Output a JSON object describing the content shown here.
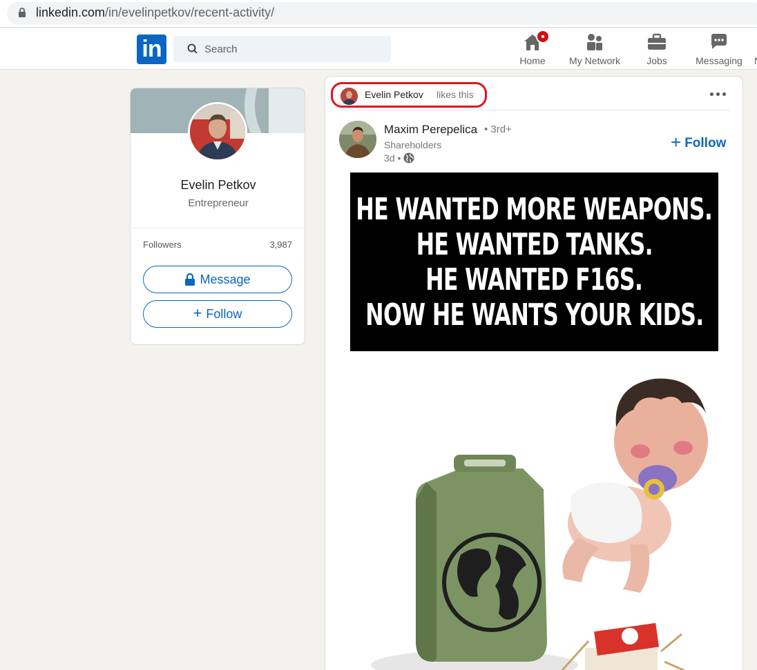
{
  "browser": {
    "url_host": "linkedin.com",
    "url_path": "/in/evelinpetkov/recent-activity/"
  },
  "nav": {
    "logo_text": "in",
    "search_placeholder": "Search",
    "items": [
      {
        "label": "Home",
        "icon": "home-icon",
        "has_notification": true
      },
      {
        "label": "My Network",
        "icon": "network-icon"
      },
      {
        "label": "Jobs",
        "icon": "briefcase-icon"
      },
      {
        "label": "Messaging",
        "icon": "messaging-icon"
      },
      {
        "label": "N",
        "icon": "notifications-icon"
      }
    ],
    "accent_color": "#0a66c2",
    "badge_color": "#cc1016"
  },
  "profile": {
    "name": "Evelin Petkov",
    "headline": "Entrepreneur",
    "followers_label": "Followers",
    "followers_count": "3,987",
    "message_label": "Message",
    "follow_label": "Follow"
  },
  "post": {
    "liker_name": "Evelin Petkov",
    "liker_action": "likes this",
    "author": {
      "name": "Maxim Perepelica",
      "degree": "• 3rd+",
      "headline": "Shareholders",
      "time": "3d •"
    },
    "follow_label": "Follow",
    "highlight_color": "#e1141c",
    "meme_lines": [
      "He wanted more weapons.",
      "He wanted tanks.",
      "He wanted F16s.",
      "Now he wants your kids."
    ]
  }
}
